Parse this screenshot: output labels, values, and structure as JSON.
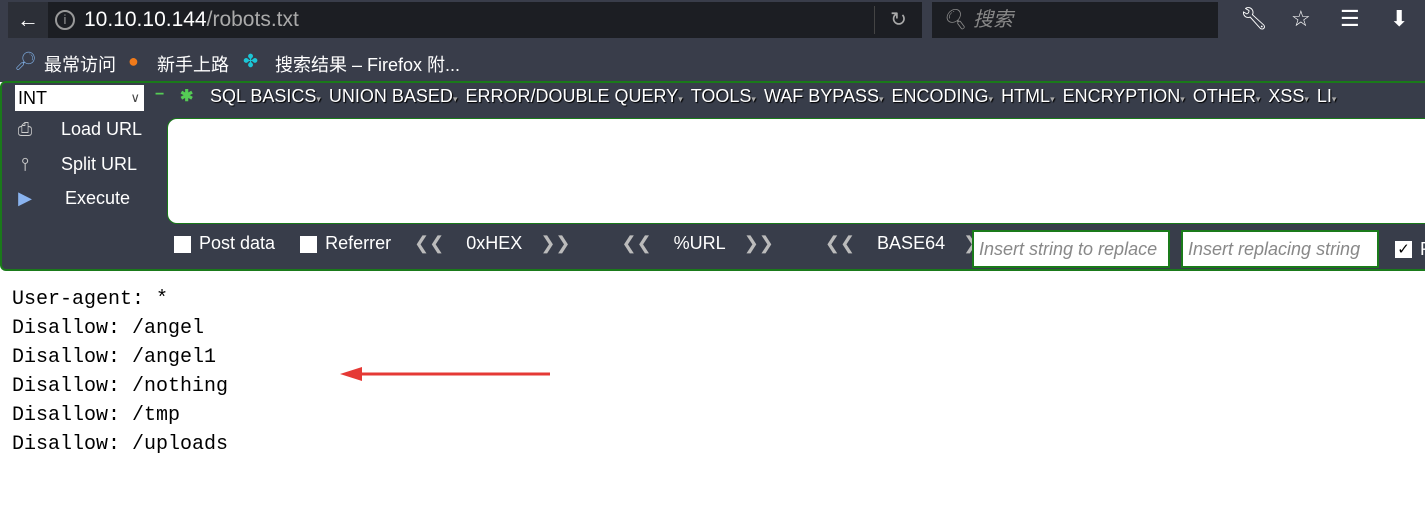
{
  "browser": {
    "url_host": "10.10.10.144",
    "url_path": "/robots.txt",
    "search_placeholder": "搜索"
  },
  "bookmarks": [
    {
      "label": "最常访问"
    },
    {
      "label": "新手上路"
    },
    {
      "label": "搜索结果 – Firefox 附..."
    }
  ],
  "hackbar": {
    "type_select": "INT",
    "menus": [
      "SQL BASICS",
      "UNION BASED",
      "ERROR/DOUBLE QUERY",
      "TOOLS",
      "WAF BYPASS",
      "ENCODING",
      "HTML",
      "ENCRYPTION",
      "OTHER",
      "XSS",
      "LI"
    ],
    "actions": [
      "Load URL",
      "Split URL",
      "Execute"
    ],
    "post_data": "Post data",
    "referrer": "Referrer",
    "encoders": [
      "0xHEX",
      "%URL",
      "BASE64"
    ],
    "replace_placeholder": "Insert string to replace",
    "replacing_placeholder": "Insert replacing string",
    "last_checkbox_label": "R"
  },
  "content": {
    "lines": [
      "User-agent: *",
      "Disallow: /angel",
      "Disallow: /angel1",
      "Disallow: /nothing",
      "Disallow: /tmp",
      "Disallow: /uploads"
    ]
  },
  "annotation": {
    "arrow_color": "#e53935"
  }
}
